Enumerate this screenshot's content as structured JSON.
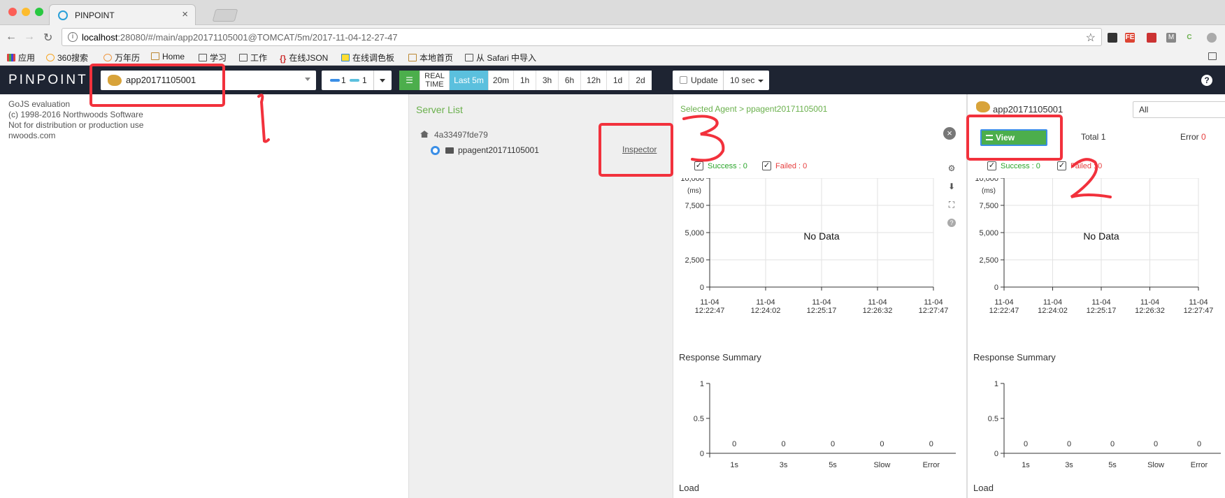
{
  "browser": {
    "tab_title": "PINPOINT",
    "url_host": "localhost",
    "url_rest": ":28080/#/main/app20171105001@TOMCAT/5m/2017-11-04-12-27-47",
    "bookmarks": [
      "应用",
      "360搜索",
      "万年历",
      "Home",
      "学习",
      "工作",
      "在线JSON",
      "在线调色板",
      "本地首页",
      "从 Safari 中导入"
    ]
  },
  "header": {
    "logo": "PINPOINT",
    "app_name": "app20171105001",
    "inbound": "1",
    "outbound": "1",
    "realtime": [
      "REAL",
      "TIME"
    ],
    "ranges": [
      "Last 5m",
      "20m",
      "1h",
      "3h",
      "6h",
      "12h",
      "1d",
      "2d"
    ],
    "active_range": "Last 5m",
    "update_label": "Update",
    "interval": "10 sec"
  },
  "gojs": [
    "GoJS evaluation",
    "(c) 1998-2016 Northwoods Software",
    "Not for distribution or production use",
    "nwoods.com"
  ],
  "server_list": {
    "title": "Server List",
    "host": "4a33497fde79",
    "agent": "ppagent20171105001",
    "inspector": "Inspector"
  },
  "agent_panel": {
    "title": "Selected Agent > ppagent20171105001",
    "success": "Success : 0",
    "failed": "Failed : 0"
  },
  "app_panel": {
    "app_name": "app20171105001",
    "filter": "All",
    "view_servers": "View Servers",
    "total_label": "Total",
    "total_value": "1",
    "error_label": "Error",
    "error_value": "0",
    "success": "Success : 0",
    "failed": "Failed : 0"
  },
  "sections": {
    "response_summary": "Response Summary",
    "load": "Load"
  },
  "annotations": [
    "1",
    "2",
    "3"
  ],
  "chart_data": [
    {
      "type": "scatter",
      "title": "",
      "ylabel": "(ms)",
      "yticks": [
        "10,000",
        "7,500",
        "5,000",
        "2,500",
        "0"
      ],
      "ylim": [
        0,
        10000
      ],
      "xticks": [
        [
          "11-04",
          "12:22:47"
        ],
        [
          "11-04",
          "12:24:02"
        ],
        [
          "11-04",
          "12:25:17"
        ],
        [
          "11-04",
          "12:26:32"
        ],
        [
          "11-04",
          "12:27:47"
        ]
      ],
      "series": [],
      "message": "No Data",
      "grid": true
    },
    {
      "type": "bar",
      "title": "Response Summary",
      "categories": [
        "1s",
        "3s",
        "5s",
        "Slow",
        "Error"
      ],
      "values": [
        0,
        0,
        0,
        0,
        0
      ],
      "value_labels": [
        "0",
        "0",
        "0",
        "0",
        "0"
      ],
      "yticks": [
        "1",
        "0.5",
        "0"
      ],
      "ylim": [
        0,
        1
      ]
    }
  ],
  "colors": {
    "header_bg": "#1e2432",
    "accent_green": "#4cae4c",
    "active_blue": "#5bc0de",
    "success": "#2aa52a",
    "failed": "#e63d3d",
    "annotation": "#f2313c"
  }
}
